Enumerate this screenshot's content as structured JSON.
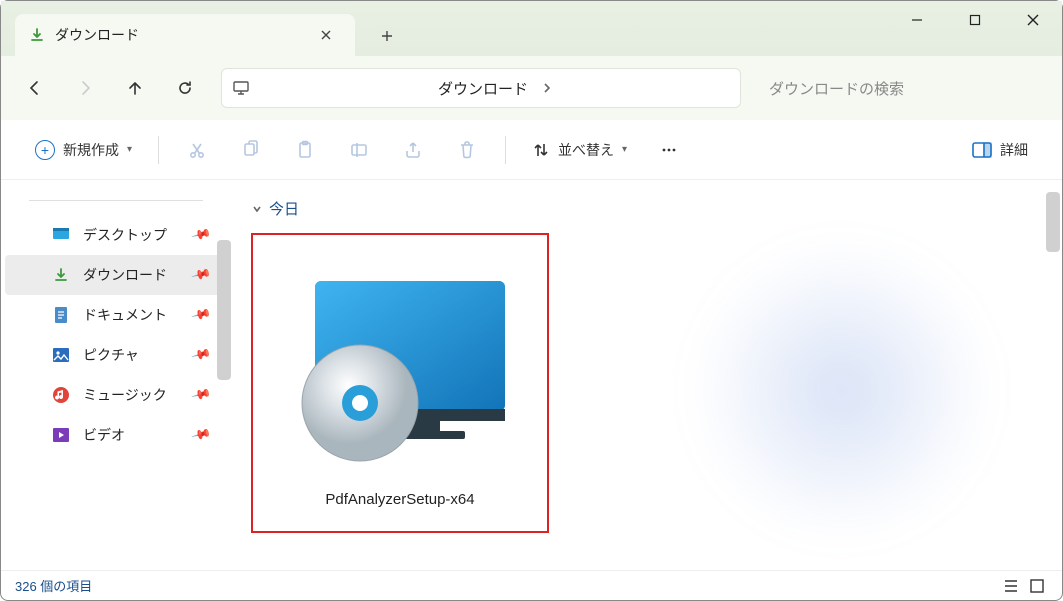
{
  "window": {
    "tab_title": "ダウンロード"
  },
  "address": {
    "current": "ダウンロード",
    "search_placeholder": "ダウンロードの検索"
  },
  "toolbar": {
    "new_label": "新規作成",
    "sort_label": "並べ替え",
    "details_label": "詳細"
  },
  "sidebar": {
    "items": [
      {
        "label": "デスクトップ"
      },
      {
        "label": "ダウンロード"
      },
      {
        "label": "ドキュメント"
      },
      {
        "label": "ピクチャ"
      },
      {
        "label": "ミュージック"
      },
      {
        "label": "ビデオ"
      }
    ]
  },
  "content": {
    "group_label": "今日",
    "files": [
      {
        "name": "PdfAnalyzerSetup-x64"
      }
    ]
  },
  "status": {
    "count_label": "326 個の項目"
  }
}
